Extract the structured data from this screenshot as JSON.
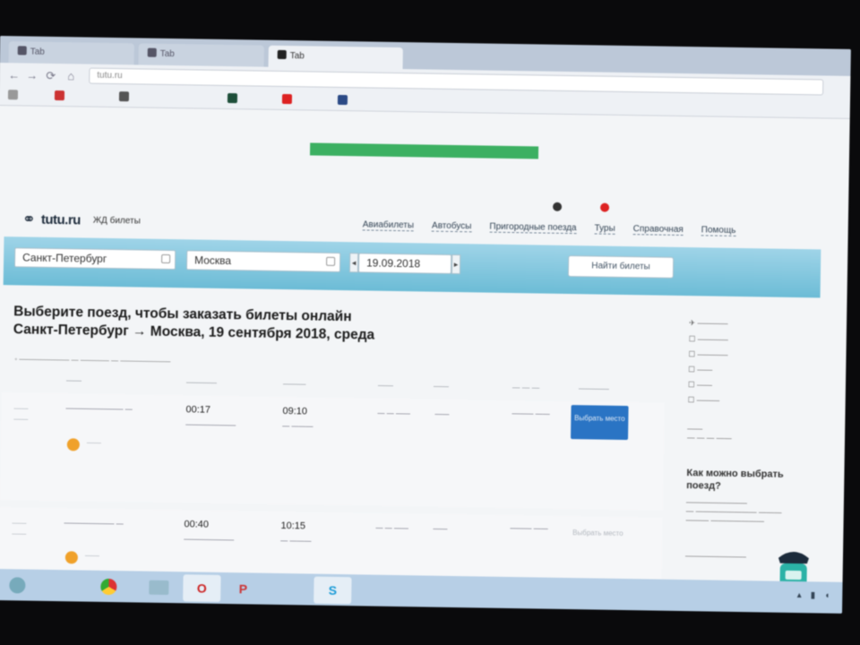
{
  "browser": {
    "tabs": [
      {
        "label": "Tab"
      },
      {
        "label": "Tab"
      },
      {
        "label": "Tab"
      }
    ],
    "url": "tutu.ru",
    "bookmarks": [
      {
        "label": ""
      },
      {
        "label": ""
      },
      {
        "label": ""
      },
      {
        "label": ""
      },
      {
        "label": ""
      },
      {
        "label": ""
      }
    ]
  },
  "header": {
    "logo": "tutu.ru",
    "section": "ЖД билеты",
    "nav": [
      "Авиабилеты",
      "Автобусы",
      "Пригородные поезда",
      "Туры",
      "Справочная",
      "Помощь"
    ]
  },
  "search": {
    "from": "Санкт-Петербург",
    "to": "Москва",
    "date": "19.09.2018",
    "find_label": "Найти билеты"
  },
  "title_line1": "Выберите поезд, чтобы заказать билеты онлайн",
  "title_line2": "Санкт-Петербург → Москва, 19 сентября 2018, среда",
  "results": {
    "rows": [
      {
        "departure": "00:17",
        "arrival": "09:10",
        "choose_label": "Выбрать место"
      },
      {
        "departure": "00:40",
        "arrival": "10:15",
        "choose_label": "Выбрать место"
      }
    ]
  },
  "sidebar": {
    "question": "Как можно выбрать поезд?"
  },
  "colors": {
    "search_bar": "#6cbcd6",
    "primary_button": "#2a74c4",
    "promo_bar": "#3cb062",
    "badge": "#f0a12a"
  }
}
